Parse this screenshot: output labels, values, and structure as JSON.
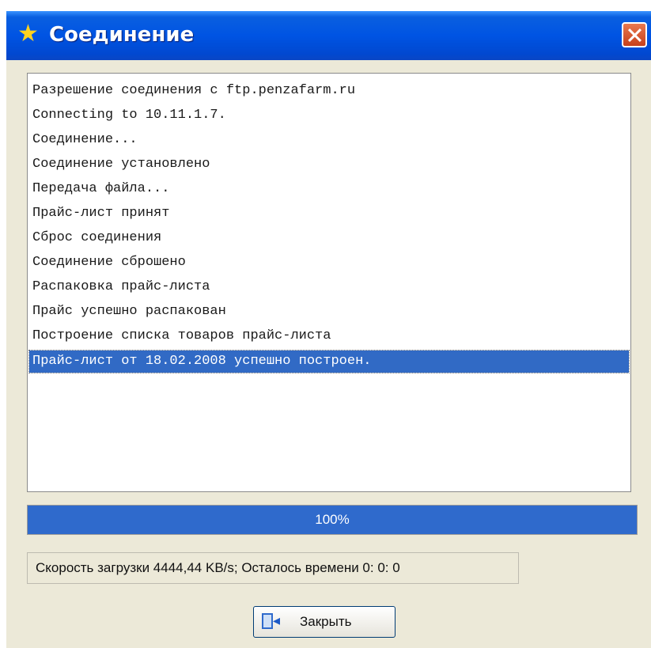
{
  "window": {
    "title": "Соединение",
    "icon": "star-icon",
    "title_color": "#0054e3"
  },
  "log": {
    "lines": [
      "Разрешение соединения с ftp.penzafarm.ru",
      "Connecting to 10.11.1.7.",
      "Соединение...",
      "Соединение установлено",
      "Передача файла...",
      "Прайс-лист принят",
      "Сброс соединения",
      "Соединение сброшено",
      "Распаковка прайс-листа",
      "Прайс успешно распакован",
      "Построение списка товаров прайс-листа",
      "Прайс-лист от 18.02.2008 успешно построен."
    ],
    "selected_index": 11
  },
  "progress": {
    "label": "100%",
    "value": 1.0,
    "color": "#2f6acc"
  },
  "status": {
    "text": "Скорость загрузки 4444,44 KB/s; Осталось времени  0: 0: 0"
  },
  "close_button": {
    "label": "Закрыть",
    "icon": "exit-door-icon"
  }
}
